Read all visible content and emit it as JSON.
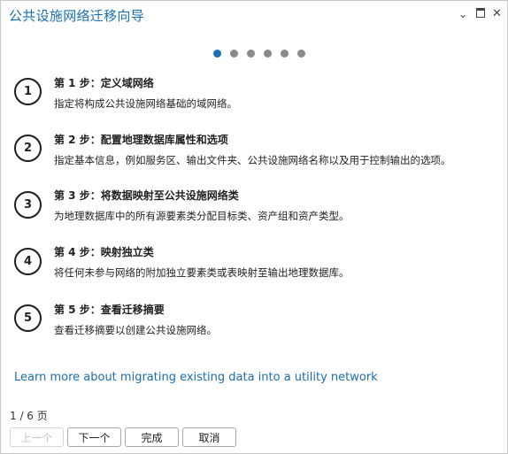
{
  "window": {
    "title": "公共设施网络迁移向导",
    "controls": {
      "collapse_icon": "chevron-down-icon",
      "maximize_icon": "maximize-icon",
      "close_icon": "close-icon"
    }
  },
  "progress_dots": {
    "count": 6,
    "active_index": 0,
    "active_color": "#1a6fae",
    "inactive_color": "#8a8a8a"
  },
  "steps": [
    {
      "number": "1",
      "title": "第 1 步：定义域网络",
      "description": "指定将构成公共设施网络基础的域网络。"
    },
    {
      "number": "2",
      "title": "第 2 步：配置地理数据库属性和选项",
      "description": "指定基本信息，例如服务区、输出文件夹、公共设施网络名称以及用于控制输出的选项。"
    },
    {
      "number": "3",
      "title": "第 3 步：将数据映射至公共设施网络类",
      "description": "为地理数据库中的所有源要素类分配目标类、资产组和资产类型。"
    },
    {
      "number": "4",
      "title": "第 4 步：映射独立类",
      "description": "将任何未参与网络的附加独立要素类或表映射至输出地理数据库。"
    },
    {
      "number": "5",
      "title": "第 5 步：查看迁移摘要",
      "description": "查看迁移摘要以创建公共设施网络。"
    }
  ],
  "learn_more": {
    "text": "Learn more about migrating existing data into a utility network"
  },
  "pagination": {
    "text": "1 / 6 页"
  },
  "buttons": {
    "previous": "上一个",
    "next": "下一个",
    "finish": "完成",
    "cancel": "取消"
  }
}
